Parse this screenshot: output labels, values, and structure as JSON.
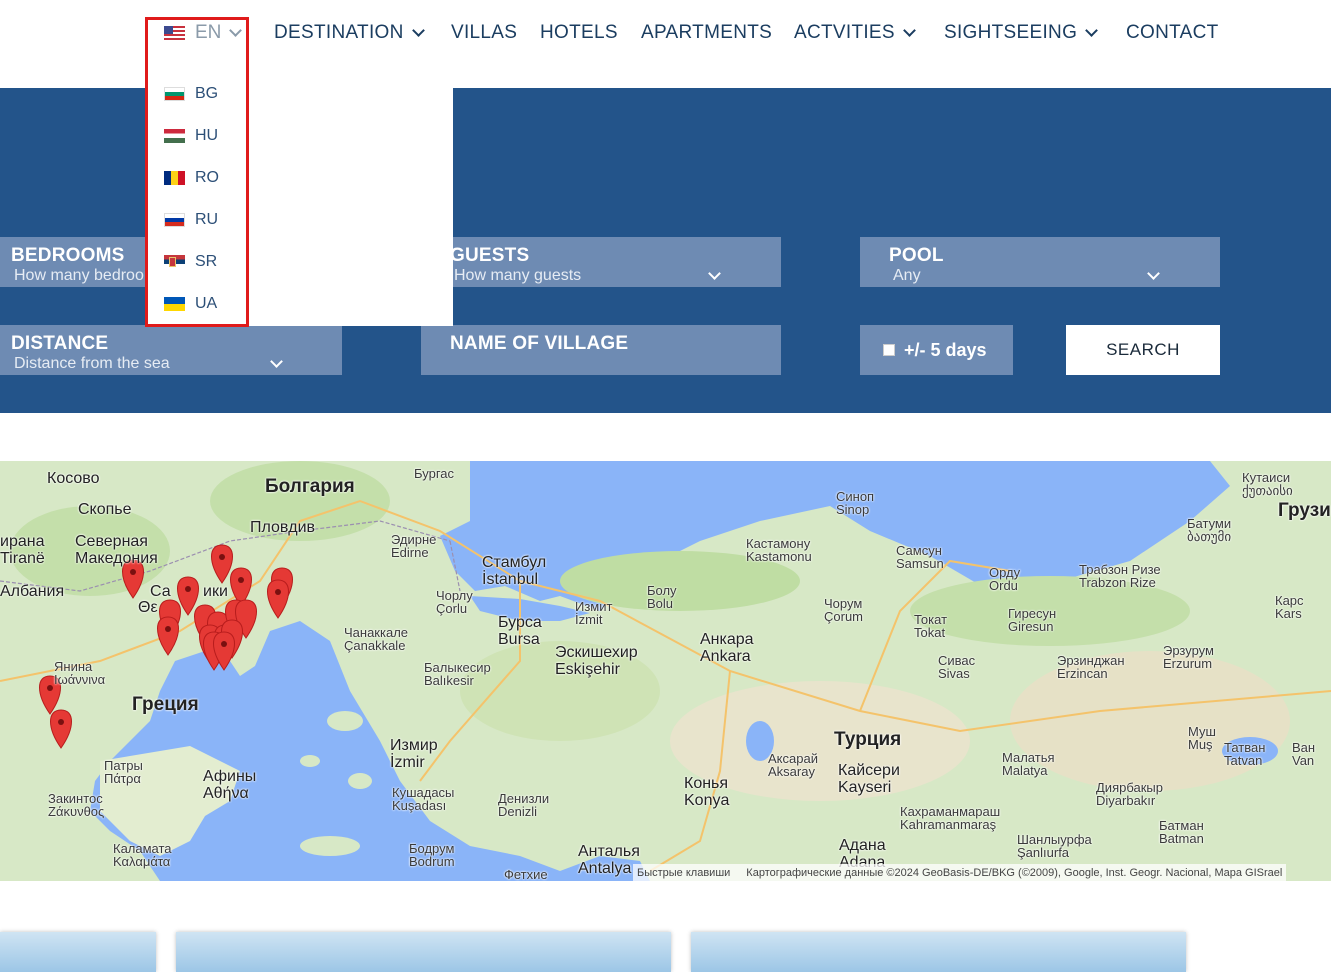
{
  "nav": {
    "language_current": "EN",
    "items": [
      "DESTINATION",
      "VILLAS",
      "HOTELS",
      "APARTMENTS",
      "ACTVITIES",
      "SIGHTSEEING",
      "CONTACT"
    ]
  },
  "language_menu": [
    {
      "code": "BG",
      "flag": "bg-flag-icon"
    },
    {
      "code": "HU",
      "flag": "hu-flag-icon"
    },
    {
      "code": "RO",
      "flag": "ro-flag-icon"
    },
    {
      "code": "RU",
      "flag": "ru-flag-icon"
    },
    {
      "code": "SR",
      "flag": "sr-flag-icon"
    },
    {
      "code": "UA",
      "flag": "ua-flag-icon"
    }
  ],
  "search": {
    "bedrooms": {
      "label": "BEDROOMS",
      "placeholder": "How many bedrooms"
    },
    "guests": {
      "label": "GUESTS",
      "placeholder": "How many guests"
    },
    "pool": {
      "label": "POOL",
      "value": "Any"
    },
    "distance": {
      "label": "DISTANCE",
      "placeholder": "Distance from the sea"
    },
    "village": {
      "label": "NAME OF VILLAGE"
    },
    "flex_days": "+/- 5 days",
    "search_button": "SEARCH"
  },
  "map": {
    "labels": [
      {
        "t": "Косово",
        "c": "mid"
      },
      {
        "t": "Болгария",
        "c": "big"
      },
      {
        "t": "Бургас",
        "c": ""
      },
      {
        "t": "Скопье",
        "c": "mid"
      },
      {
        "t": "Пловдив",
        "c": "mid"
      },
      {
        "t": "Эдирне\nEdirne",
        "c": ""
      },
      {
        "t": "Синоп\nSinop",
        "c": ""
      },
      {
        "t": "Кутаиси\nქუთაისი",
        "c": ""
      },
      {
        "t": "Грузи",
        "c": "big"
      },
      {
        "t": "ирана\nTiranë",
        "c": "mid"
      },
      {
        "t": "Северная\nМакедония",
        "c": "mid"
      },
      {
        "t": "Стамбул\nİstanbul",
        "c": "mid"
      },
      {
        "t": "Кастамону\nKastamonu",
        "c": ""
      },
      {
        "t": "Самсун\nSamsun",
        "c": ""
      },
      {
        "t": "Батуми\nბათუმი",
        "c": ""
      },
      {
        "t": "Албания",
        "c": "mid"
      },
      {
        "t": "Чорлу\nÇorlu",
        "c": ""
      },
      {
        "t": "Болу\nBolu",
        "c": ""
      },
      {
        "t": "Орду\nOrdu",
        "c": ""
      },
      {
        "t": "Трабзон Ризе\nTrabzon Rize",
        "c": ""
      },
      {
        "t": "Измит\nİzmit",
        "c": ""
      },
      {
        "t": "Чорум\nÇorum",
        "c": ""
      },
      {
        "t": "Гиресун\nGiresun",
        "c": ""
      },
      {
        "t": "Карс\nKars",
        "c": ""
      },
      {
        "t": "Бурса\nBursa",
        "c": "mid"
      },
      {
        "t": "Токат\nTokat",
        "c": ""
      },
      {
        "t": "Чанаккале\nÇanakkale",
        "c": ""
      },
      {
        "t": "Анкара\nAnkara",
        "c": "mid"
      },
      {
        "t": "Эскишехир\nEskişehir",
        "c": "mid"
      },
      {
        "t": "Эрзурум\nErzurum",
        "c": ""
      },
      {
        "t": "Янина\nΙωάννινα",
        "c": ""
      },
      {
        "t": "Балыкесир\nBalıkesir",
        "c": ""
      },
      {
        "t": "Сивас\nSivas",
        "c": ""
      },
      {
        "t": "Эрзинджан\nErzincan",
        "c": ""
      },
      {
        "t": "Греция",
        "c": "big"
      },
      {
        "t": "Турция",
        "c": "big"
      },
      {
        "t": "Измир\nİzmir",
        "c": "mid"
      },
      {
        "t": "Муш\nMuş",
        "c": ""
      },
      {
        "t": "Татван\nTatvan",
        "c": ""
      },
      {
        "t": "Ван\nVan",
        "c": ""
      },
      {
        "t": "Патры\nΠάτρα",
        "c": ""
      },
      {
        "t": "Аксарай\nAksaray",
        "c": ""
      },
      {
        "t": "Кайсери\nKayseri",
        "c": "mid"
      },
      {
        "t": "Малатья\nMalatya",
        "c": ""
      },
      {
        "t": "Афины\nΑθήνα",
        "c": "mid"
      },
      {
        "t": "Конья\nKonya",
        "c": "mid"
      },
      {
        "t": "Закинтос\nΖάκυνθος",
        "c": ""
      },
      {
        "t": "Кушадасы\nKuşadası",
        "c": ""
      },
      {
        "t": "Денизли\nDenizli",
        "c": ""
      },
      {
        "t": "Диярбакыр\nDiyarbakır",
        "c": ""
      },
      {
        "t": "Кахраманмараш\nKahramanmaraş",
        "c": ""
      },
      {
        "t": "Батман\nBatman",
        "c": ""
      },
      {
        "t": "Каламата\nΚαλαμάτα",
        "c": ""
      },
      {
        "t": "Бодрум\nBodrum",
        "c": ""
      },
      {
        "t": "Анталья\nAntalya",
        "c": "mid"
      },
      {
        "t": "Адана\nAdana",
        "c": "mid"
      },
      {
        "t": "Шанлыурфа\nŞanlıurfa",
        "c": ""
      },
      {
        "t": "Фетхие",
        "c": ""
      },
      {
        "t": "Са",
        "c": "mid"
      },
      {
        "t": "ики",
        "c": "mid"
      },
      {
        "t": "Θε",
        "c": "mid"
      }
    ],
    "attribution": [
      "Быстрые клавиши",
      "Картографические данные ©2024 GeoBasis-DE/BKG (©2009), Google, Inst. Geogr. Nacional, Mapa GISrael"
    ]
  },
  "colors": {
    "band": "#23548a",
    "field": "#6e8bb3",
    "highlight": "#e01b1b",
    "marker": "#e53935",
    "sea": "#8ab4f8",
    "land": "#d7e8c6"
  }
}
